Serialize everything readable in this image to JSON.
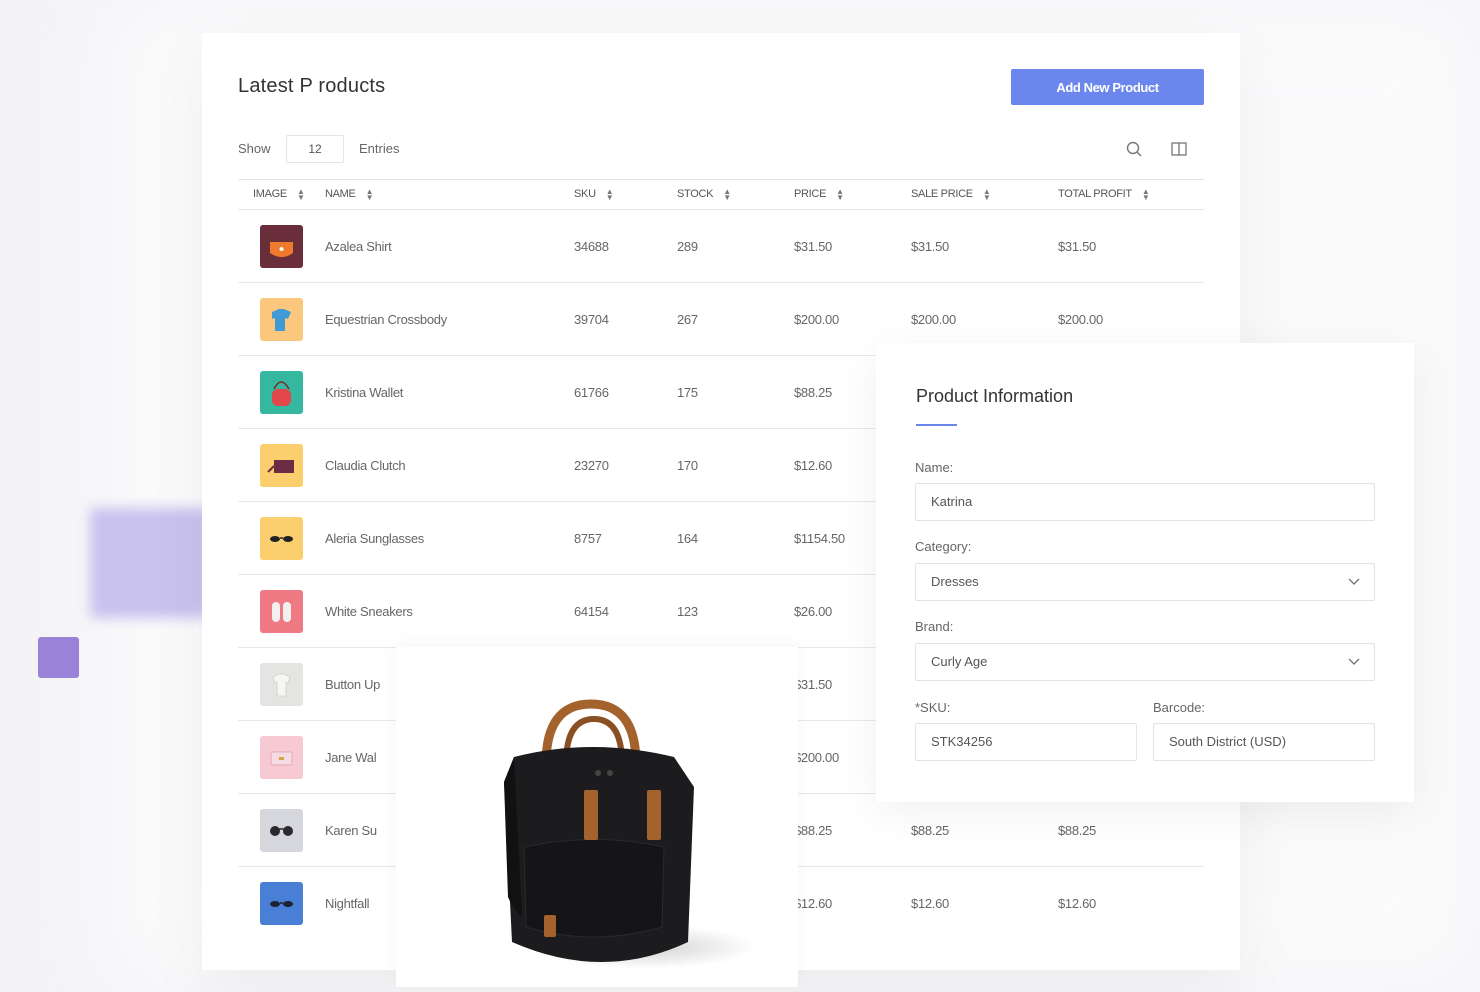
{
  "colors": {
    "accent": "#6b86ec",
    "deco_purple": "#9b82d9",
    "deco_lavender": "#c9c1ee"
  },
  "products_card": {
    "title": "Latest P roducts",
    "add_button": "Add New Product",
    "show_label": "Show",
    "entries_value": "12",
    "entries_label": "Entries",
    "icons": [
      "search-icon",
      "columns-icon"
    ],
    "columns": [
      "IMAGE",
      "NAME",
      "SKU",
      "STOCK",
      "PRICE",
      "SALE PRICE",
      "TOTAL PROFIT"
    ],
    "rows": [
      {
        "thumb": "orange-bag",
        "name": "Azalea Shirt",
        "sku": "34688",
        "stock": "289",
        "price": "$31.50",
        "sale": "$31.50",
        "profit": "$31.50"
      },
      {
        "thumb": "blue-shirt",
        "name": "Equestrian Crossbody",
        "sku": "39704",
        "stock": "267",
        "price": "$200.00",
        "sale": "$200.00",
        "profit": "$200.00"
      },
      {
        "thumb": "red-bag",
        "name": "Kristina Wallet",
        "sku": "61766",
        "stock": "175",
        "price": "$88.25",
        "sale": "",
        "profit": ""
      },
      {
        "thumb": "clutch",
        "name": "Claudia Clutch",
        "sku": "23270",
        "stock": "170",
        "price": "$12.60",
        "sale": "",
        "profit": ""
      },
      {
        "thumb": "sunglasses",
        "name": "Aleria Sunglasses",
        "sku": "8757",
        "stock": "164",
        "price": "$1154.50",
        "sale": "",
        "profit": ""
      },
      {
        "thumb": "sneakers",
        "name": "White Sneakers",
        "sku": "64154",
        "stock": "123",
        "price": "$26.00",
        "sale": "",
        "profit": ""
      },
      {
        "thumb": "shirt-white",
        "name": "Button Up",
        "sku": "",
        "stock": "",
        "price": "$31.50",
        "sale": "",
        "profit": ""
      },
      {
        "thumb": "pink-wallet",
        "name": "Jane Wal",
        "sku": "",
        "stock": "",
        "price": "$200.00",
        "sale": "",
        "profit": ""
      },
      {
        "thumb": "dark-glasses",
        "name": "Karen Su",
        "sku": "",
        "stock": "",
        "price": "$88.25",
        "sale": "$88.25",
        "profit": "$88.25"
      },
      {
        "thumb": "blue-glasses",
        "name": "Nightfall",
        "sku": "",
        "stock": "",
        "price": "$12.60",
        "sale": "$12.60",
        "profit": "$12.60"
      }
    ]
  },
  "info_card": {
    "title": "Product Information",
    "name_label": "Name:",
    "name_value": "Katrina",
    "category_label": "Category:",
    "category_value": "Dresses",
    "brand_label": "Brand:",
    "brand_value": "Curly Age",
    "sku_label": "*SKU:",
    "sku_value": "STK34256",
    "barcode_label": "Barcode:",
    "barcode_value": "South District (USD)"
  },
  "backpack_card": {
    "image": "black-backpack"
  }
}
